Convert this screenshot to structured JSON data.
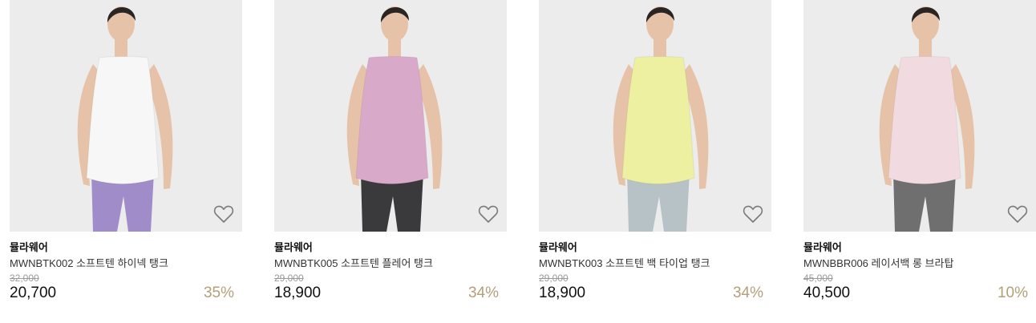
{
  "products": [
    {
      "brand": "뮬라웨어",
      "name": "MWNBTK002 소프트텐 하이넥 탱크",
      "original_price": "32,000",
      "sale_price": "20,700",
      "discount": "35%",
      "top_color": "#f7f7f7",
      "bottom_color": "#a08cc9",
      "wishlist_icon": "heart-outline-icon"
    },
    {
      "brand": "뮬라웨어",
      "name": "MWNBTK005 소프트텐 플레어 탱크",
      "original_price": "29,000",
      "sale_price": "18,900",
      "discount": "34%",
      "top_color": "#d9a9c9",
      "bottom_color": "#3a3a3c",
      "wishlist_icon": "heart-outline-icon"
    },
    {
      "brand": "뮬라웨어",
      "name": "MWNBTK003 소프트텐 백 타이업 탱크",
      "original_price": "29,000",
      "sale_price": "18,900",
      "discount": "34%",
      "top_color": "#edf0a0",
      "bottom_color": "#b7c2c6",
      "wishlist_icon": "heart-outline-icon"
    },
    {
      "brand": "뮬라웨어",
      "name": "MWNBBR006 레이서백 롱 브라탑",
      "original_price": "45,000",
      "sale_price": "40,500",
      "discount": "10%",
      "top_color": "#f2dbe0",
      "bottom_color": "#6f6f6f",
      "wishlist_icon": "heart-outline-icon"
    }
  ],
  "colors": {
    "discount": "#b3a078",
    "photo_bg": "#ececec"
  }
}
